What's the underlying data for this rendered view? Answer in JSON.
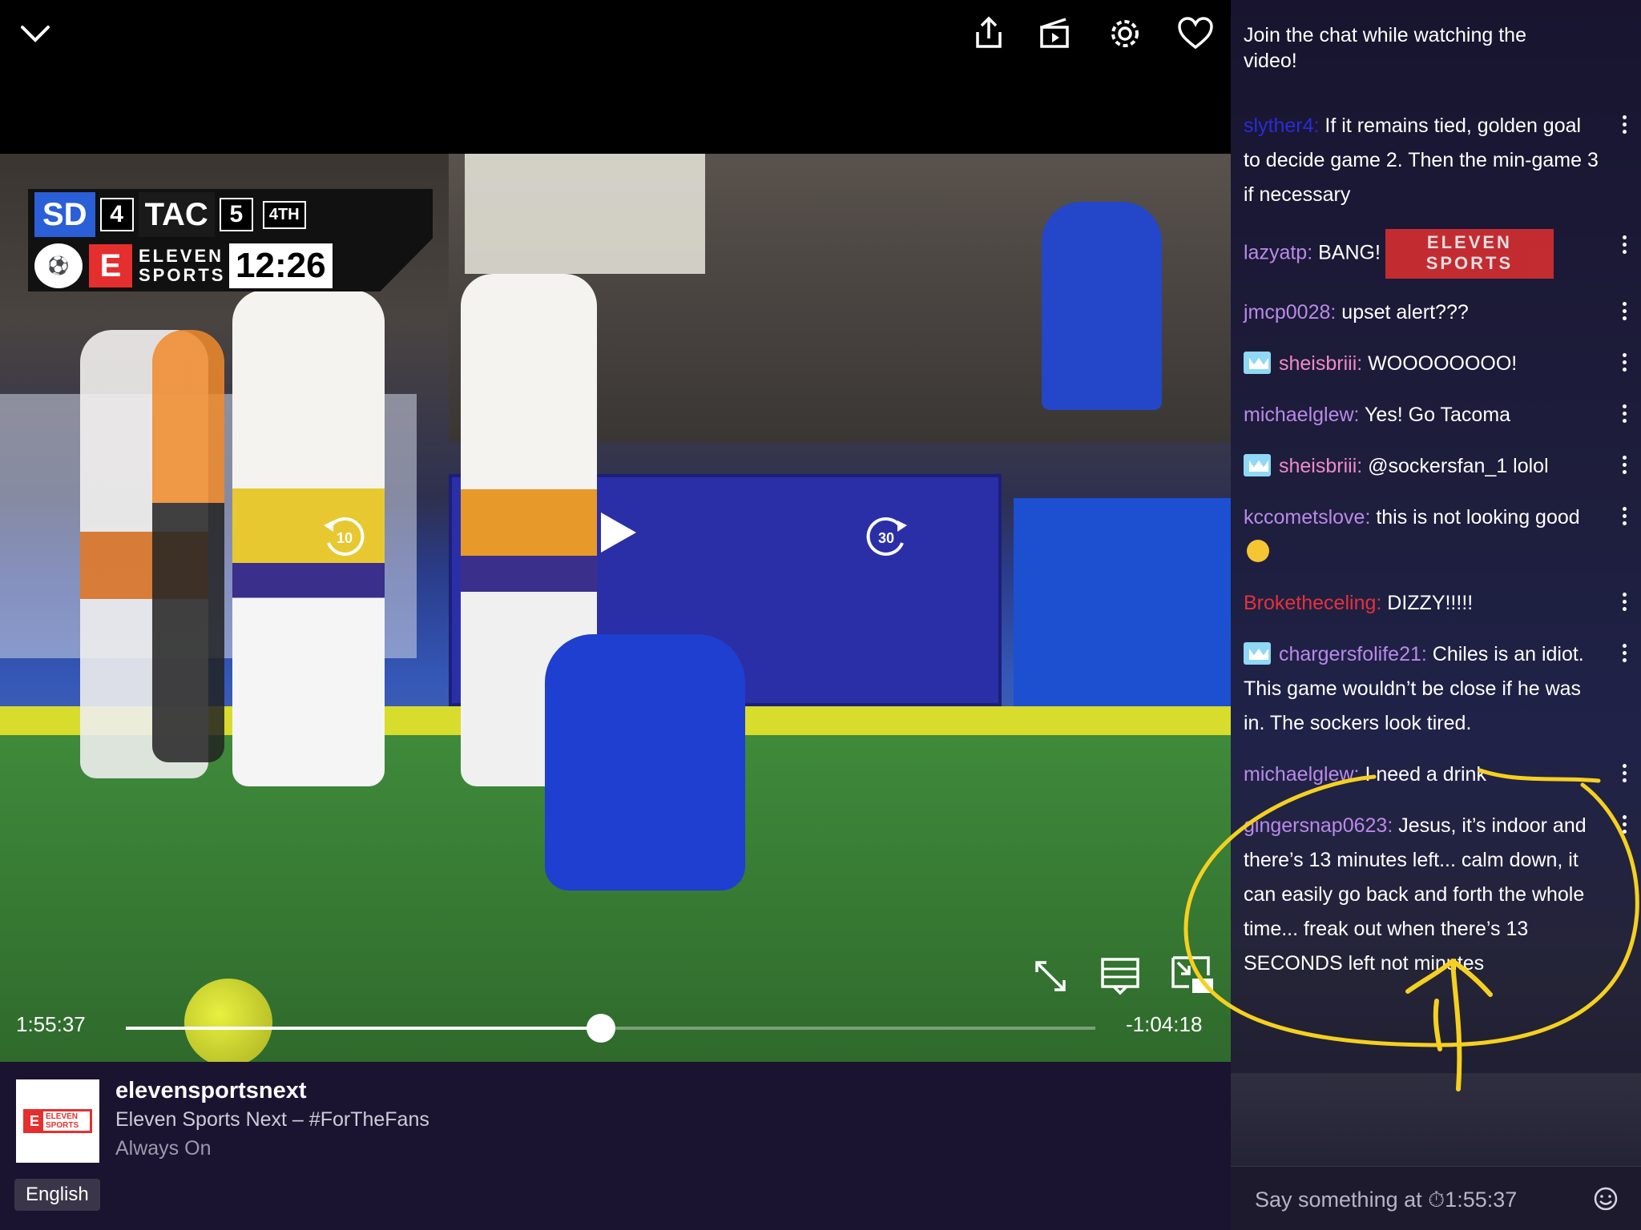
{
  "player": {
    "scoreboard": {
      "home_team": "SD",
      "home_score": "4",
      "away_team": "TAC",
      "away_score": "5",
      "period": "4TH",
      "brand_letter": "E",
      "brand_line1": "ELEVEN",
      "brand_line2": "SPORTS",
      "clock": "12:26"
    },
    "rewind_seconds": "10",
    "forward_seconds": "30",
    "elapsed": "1:55:37",
    "remaining": "-1:04:18",
    "progress": 0.49
  },
  "info": {
    "channel_name": "elevensportsnext",
    "title": "Eleven Sports Next – #ForTheFans",
    "status": "Always On",
    "language": "English",
    "logo_line1": "ELEVEN",
    "logo_line2": "SPORTS"
  },
  "chat": {
    "header": "Join the chat while watching the video!",
    "messages": [
      {
        "user": "slyther4:",
        "color": "#2b2bd8",
        "sub": false,
        "text": " If it remains tied, golden goal to decide game 2. Then the min-game 3 if necessary"
      },
      {
        "user": "lazyatp:",
        "color": "#b98ae8",
        "sub": false,
        "text": " BANG!",
        "emote_line1": "ELEVEN",
        "emote_line2": "SPORTS"
      },
      {
        "user": "jmcp0028:",
        "color": "#b98ae8",
        "sub": false,
        "text": " upset alert???"
      },
      {
        "user": "sheisbriii:",
        "color": "#f08ac8",
        "sub": true,
        "text": " WOOOOOOOO!"
      },
      {
        "user": "michaelglew:",
        "color": "#b98ae8",
        "sub": false,
        "text": " Yes! Go Tacoma"
      },
      {
        "user": "sheisbriii:",
        "color": "#f08ac8",
        "sub": true,
        "text": " @sockersfan_1 lolol"
      },
      {
        "user": "kccometslove:",
        "color": "#b98ae8",
        "sub": false,
        "text": " this is not looking good"
      },
      {
        "user": "Broketheceling:",
        "color": "#e8303a",
        "sub": false,
        "text": " DIZZY!!!!!"
      },
      {
        "user": "chargersfolife21:",
        "color": "#b98ae8",
        "sub": true,
        "text": " Chiles is an idiot. This game wouldn’t be close if he was in. The sockers look tired."
      },
      {
        "user": "michaelglew:",
        "color": "#b98ae8",
        "sub": false,
        "text": " I need a drink"
      },
      {
        "user": "gingersnap0623:",
        "color": "#b98ae8",
        "sub": false,
        "text": " Jesus, it’s indoor and there’s 13 minutes left... calm down, it can easily go back and forth the whole time... freak out when there’s 13 SECONDS left not minutes"
      }
    ],
    "input_placeholder": "Say something at ⏱1:55:37"
  },
  "colors": {
    "chat_bg": "#1d1838",
    "info_bg": "#1a1430",
    "annotation": "#f5d020",
    "brand_red": "#e52f2f"
  },
  "icons": [
    "chevron-down-icon",
    "share-icon",
    "clip-icon",
    "gear-icon",
    "heart-icon",
    "rewind-10-icon",
    "play-icon",
    "forward-30-icon",
    "fullscreen-icon",
    "chat-toggle-icon",
    "picture-in-picture-icon",
    "emoji-icon"
  ]
}
